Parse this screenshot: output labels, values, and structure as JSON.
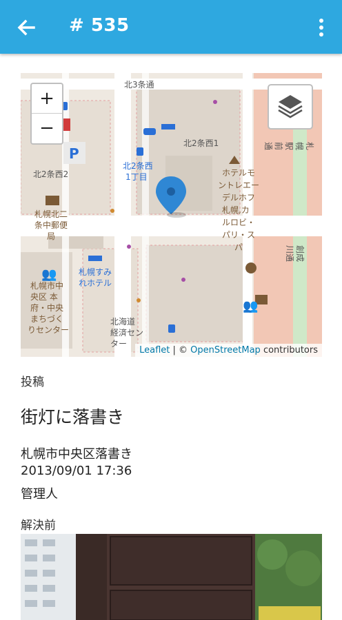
{
  "appbar": {
    "title": "# 535",
    "back_icon": "arrow-left-icon",
    "menu_icon": "more-vert-icon",
    "color": "#2ea8e0"
  },
  "map": {
    "zoom_in": "+",
    "zoom_out": "−",
    "attribution_leaflet": "Leaflet",
    "attribution_sep": " | © ",
    "attribution_osm": "OpenStreetMap",
    "attribution_rest": " contributors",
    "labels": {
      "kita3jo": "北3条通",
      "kita2jonishi1": "北2条西1",
      "kita2jonishi2": "北2条西2",
      "kita2jonishi1chome": "北2条西",
      "kita2jonishi1chome_b": "1丁目",
      "hotel_1": "ホテルモ",
      "hotel_2": "ントレエー",
      "hotel_3": "デルホフ",
      "hotel_4": "札幌,カ",
      "hotel_5": "ルロビ・",
      "hotel_6": "パリ・ス",
      "hotel_7": "パ",
      "post_1": "札幌北二",
      "post_2": "条中郵便",
      "post_3": "局",
      "sumire_1": "札幌すみ",
      "sumire_2": "れホテル",
      "center_1": "札幌市中",
      "center_2": "央区 本",
      "center_3": "府・中央",
      "center_4": "まちづく",
      "center_5": "りセンター",
      "keizai_1": "北海道",
      "keizai_2": "経済セン",
      "keizai_3": "ター",
      "ekimae": "札幌駅前通",
      "jinja": "創成川通"
    }
  },
  "post": {
    "section_label": "投稿",
    "title": "街灯に落書き",
    "category": "札幌市中央区落書き",
    "datetime": "2013/09/01 17:36",
    "author": "管理人",
    "before_label": "解決前"
  }
}
